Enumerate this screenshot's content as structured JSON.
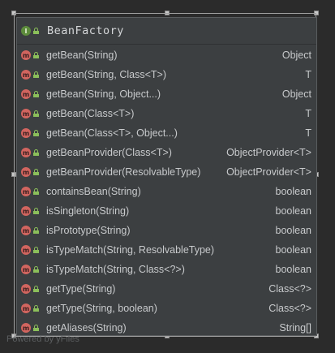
{
  "diagram": {
    "title": "BeanFactory",
    "kind_icon": "interface-icon",
    "header_icon_letter": "I",
    "method_icon_letter": "m",
    "methods": [
      {
        "signature": "getBean(String)",
        "returns": "Object"
      },
      {
        "signature": "getBean(String, Class<T>)",
        "returns": "T"
      },
      {
        "signature": "getBean(String, Object...)",
        "returns": "Object"
      },
      {
        "signature": "getBean(Class<T>)",
        "returns": "T"
      },
      {
        "signature": "getBean(Class<T>, Object...)",
        "returns": "T"
      },
      {
        "signature": "getBeanProvider(Class<T>)",
        "returns": "ObjectProvider<T>"
      },
      {
        "signature": "getBeanProvider(ResolvableType)",
        "returns": "ObjectProvider<T>"
      },
      {
        "signature": "containsBean(String)",
        "returns": "boolean"
      },
      {
        "signature": "isSingleton(String)",
        "returns": "boolean"
      },
      {
        "signature": "isPrototype(String)",
        "returns": "boolean"
      },
      {
        "signature": "isTypeMatch(String, ResolvableType)",
        "returns": "boolean"
      },
      {
        "signature": "isTypeMatch(String, Class<?>)",
        "returns": "boolean"
      },
      {
        "signature": "getType(String)",
        "returns": "Class<?>"
      },
      {
        "signature": "getType(String, boolean)",
        "returns": "Class<?>"
      },
      {
        "signature": "getAliases(String)",
        "returns": "String[]"
      }
    ]
  },
  "watermark": "Powered by yFiles",
  "colors": {
    "background": "#2b2b2b",
    "node_fill": "#3c3f41",
    "interface_icon": "#5d8c3c",
    "method_icon": "#d1655f",
    "public_lock": "#8bbf5a",
    "text": "#c8cacc"
  }
}
